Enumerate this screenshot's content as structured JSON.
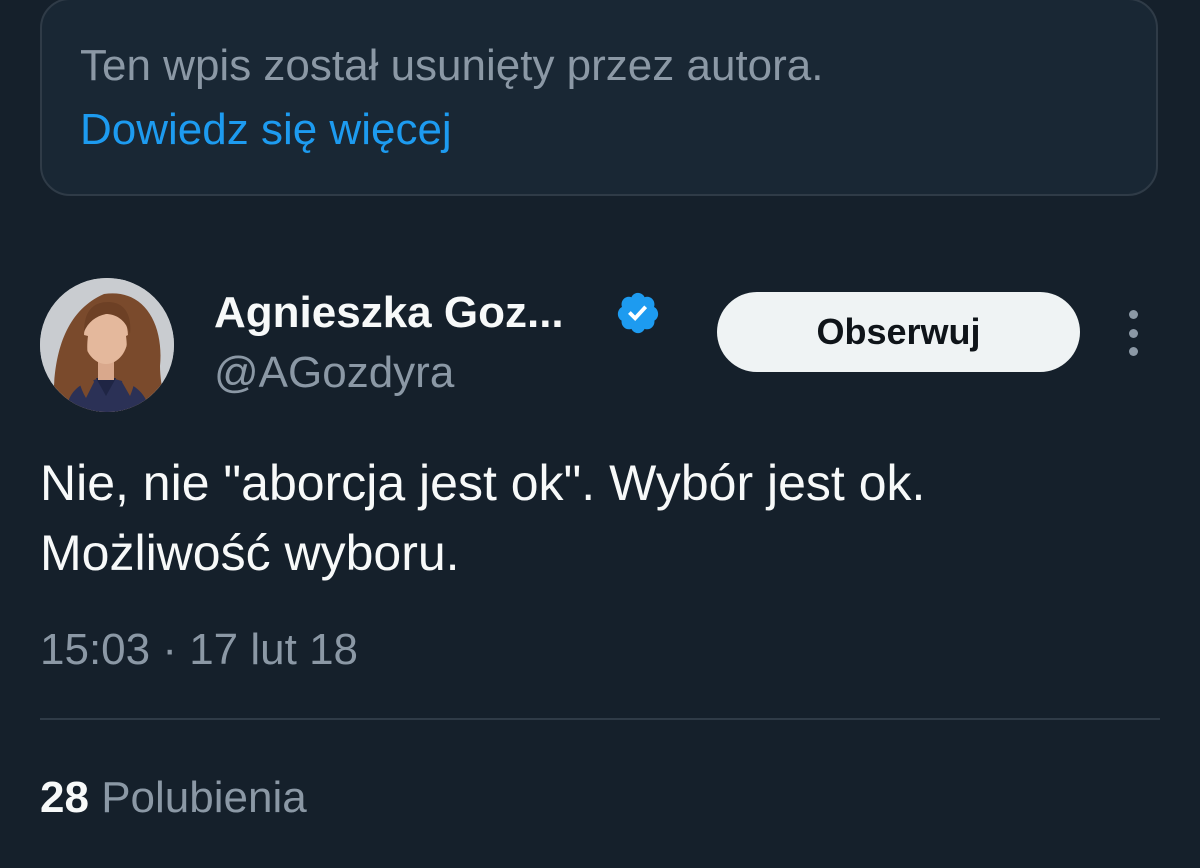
{
  "quoted_tweet": {
    "deleted_notice": "Ten wpis został usunięty przez autora.",
    "learn_more_link": "Dowiedz się więcej"
  },
  "author": {
    "display_name": "Agnieszka Goz...",
    "handle": "@AGozdyra",
    "verified": true,
    "avatar_icon": "profile-photo"
  },
  "follow_button": {
    "label": "Obserwuj"
  },
  "more_menu_icon": "more-vertical-icon",
  "tweet": {
    "text_lines": [
      "Nie, nie \"aborcja jest ok\". Wybór jest ok.",
      "Możliwość wyboru."
    ],
    "timestamp": "15:03 · 17 lut 18"
  },
  "stats": {
    "likes_count": "28",
    "likes_label": "Polubienia"
  },
  "colors": {
    "background": "#15202b",
    "accent": "#1d9bf0",
    "secondary_text": "#8b98a5",
    "primary_text": "#f7f9f9"
  }
}
